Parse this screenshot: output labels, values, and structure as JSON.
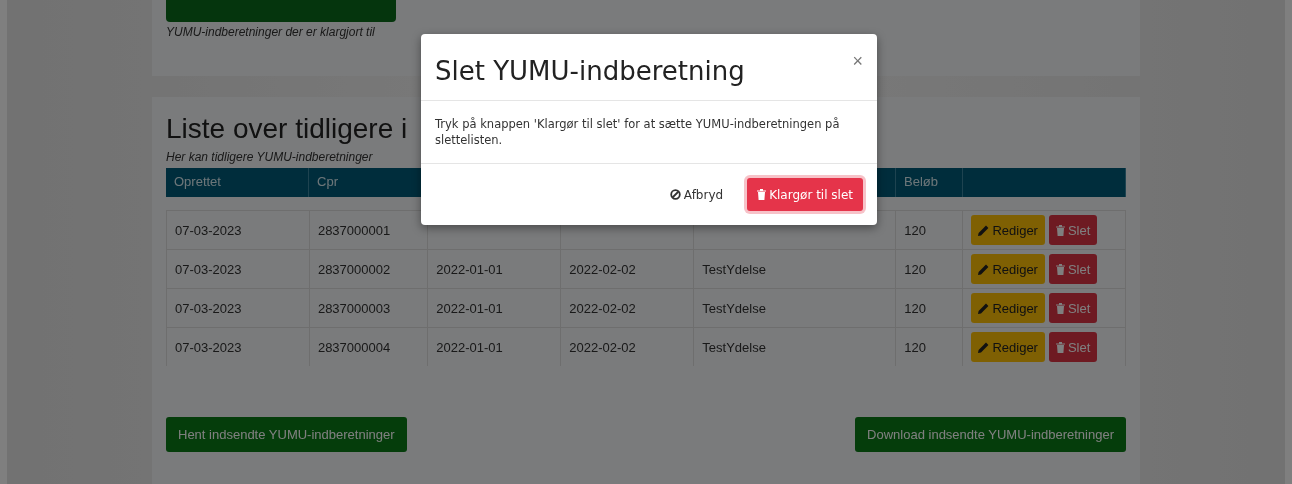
{
  "top_card": {
    "note": "YUMU-indberetninger der er klargjort til"
  },
  "list_card": {
    "title": "Liste over tidligere i",
    "subtitle": "Her kan tidligere YUMU-indberetninger",
    "table": {
      "header": {
        "created": "Oprettet",
        "cpr": "Cpr",
        "amount": "Beløb"
      },
      "rows": [
        {
          "created": "07-03-2023",
          "cpr": "2837000001",
          "amount": "120",
          "actions": [
            {
              "kind": "edit",
              "label": "Rediger"
            },
            {
              "kind": "delete",
              "label": "Slet"
            }
          ]
        },
        {
          "created": "07-03-2023",
          "cpr": "2837000002",
          "column_3": "2022-01-01",
          "column_4": "2022-02-02",
          "column_5": "TestYdelse",
          "amount": "120",
          "actions": [
            {
              "kind": "edit",
              "label": "Rediger"
            },
            {
              "kind": "delete",
              "label": "Slet"
            }
          ]
        },
        {
          "created": "07-03-2023",
          "cpr": "2837000003",
          "column_3": "2022-01-01",
          "column_4": "2022-02-02",
          "column_5": "TestYdelse",
          "amount": "120",
          "actions": [
            {
              "kind": "edit",
              "label": "Rediger"
            },
            {
              "kind": "delete",
              "label": "Slet"
            }
          ]
        },
        {
          "created": "07-03-2023",
          "cpr": "2837000004",
          "column_3": "2022-01-01",
          "column_4": "2022-02-02",
          "column_5": "TestYdelse",
          "amount": "120",
          "actions": [
            {
              "kind": "edit",
              "label": "Rediger"
            },
            {
              "kind": "delete",
              "label": "Slet"
            }
          ]
        }
      ]
    },
    "buttons": [
      {
        "label": "Hent indsendte YUMU-indberetninger"
      },
      {
        "label": "Download indsendte YUMU-indberetninger"
      }
    ]
  },
  "modal": {
    "title": "Slet YUMU-indberetning",
    "close": "×",
    "body": "Tryk på knappen 'Klargør til slet' for at sætte YUMU-indberetningen på slettelisten.",
    "buttons": [
      {
        "kind": "cancel",
        "label": "Afbryd"
      },
      {
        "kind": "confirm",
        "label": "Klargør til slet"
      }
    ]
  }
}
